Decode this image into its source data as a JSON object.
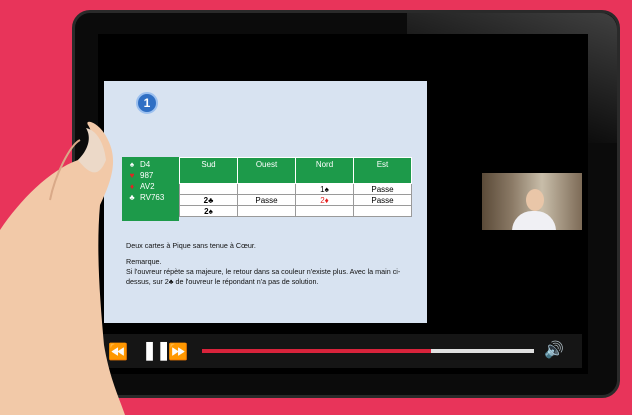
{
  "slide": {
    "number": "1",
    "hand": [
      {
        "suit": "♠",
        "cards": "D4",
        "red": false
      },
      {
        "suit": "♥",
        "cards": "987",
        "red": true
      },
      {
        "suit": "♦",
        "cards": "AV2",
        "red": true
      },
      {
        "suit": "♣",
        "cards": "RV763",
        "red": false
      }
    ],
    "bidding": {
      "headers": [
        "Sud",
        "Ouest",
        "Nord",
        "Est"
      ],
      "rows": [
        [
          "",
          "",
          "1♠",
          "Passe"
        ],
        [
          "2♣",
          "Passe",
          "2♦",
          "Passe"
        ],
        [
          "2♠",
          "",
          "",
          ""
        ]
      ]
    },
    "text_line1": "Deux cartes à Pique sans tenue à Cœur.",
    "remark_title": "Remarque.",
    "remark_body": "Si l'ouvreur répète sa majeure, le retour dans sa couleur n'existe plus. Avec la main ci-dessus, sur 2♣ de l'ouvreur le répondant n'a pas de solution."
  },
  "player": {
    "rewind_icon": "⏪",
    "pause_icon": "❚❚",
    "forward_icon": "⏩",
    "volume_icon": "🔊",
    "progress": 0.69
  },
  "colors": {
    "background": "#e8345a",
    "table_header": "#1d9a4a",
    "progress": "#d8233b"
  }
}
